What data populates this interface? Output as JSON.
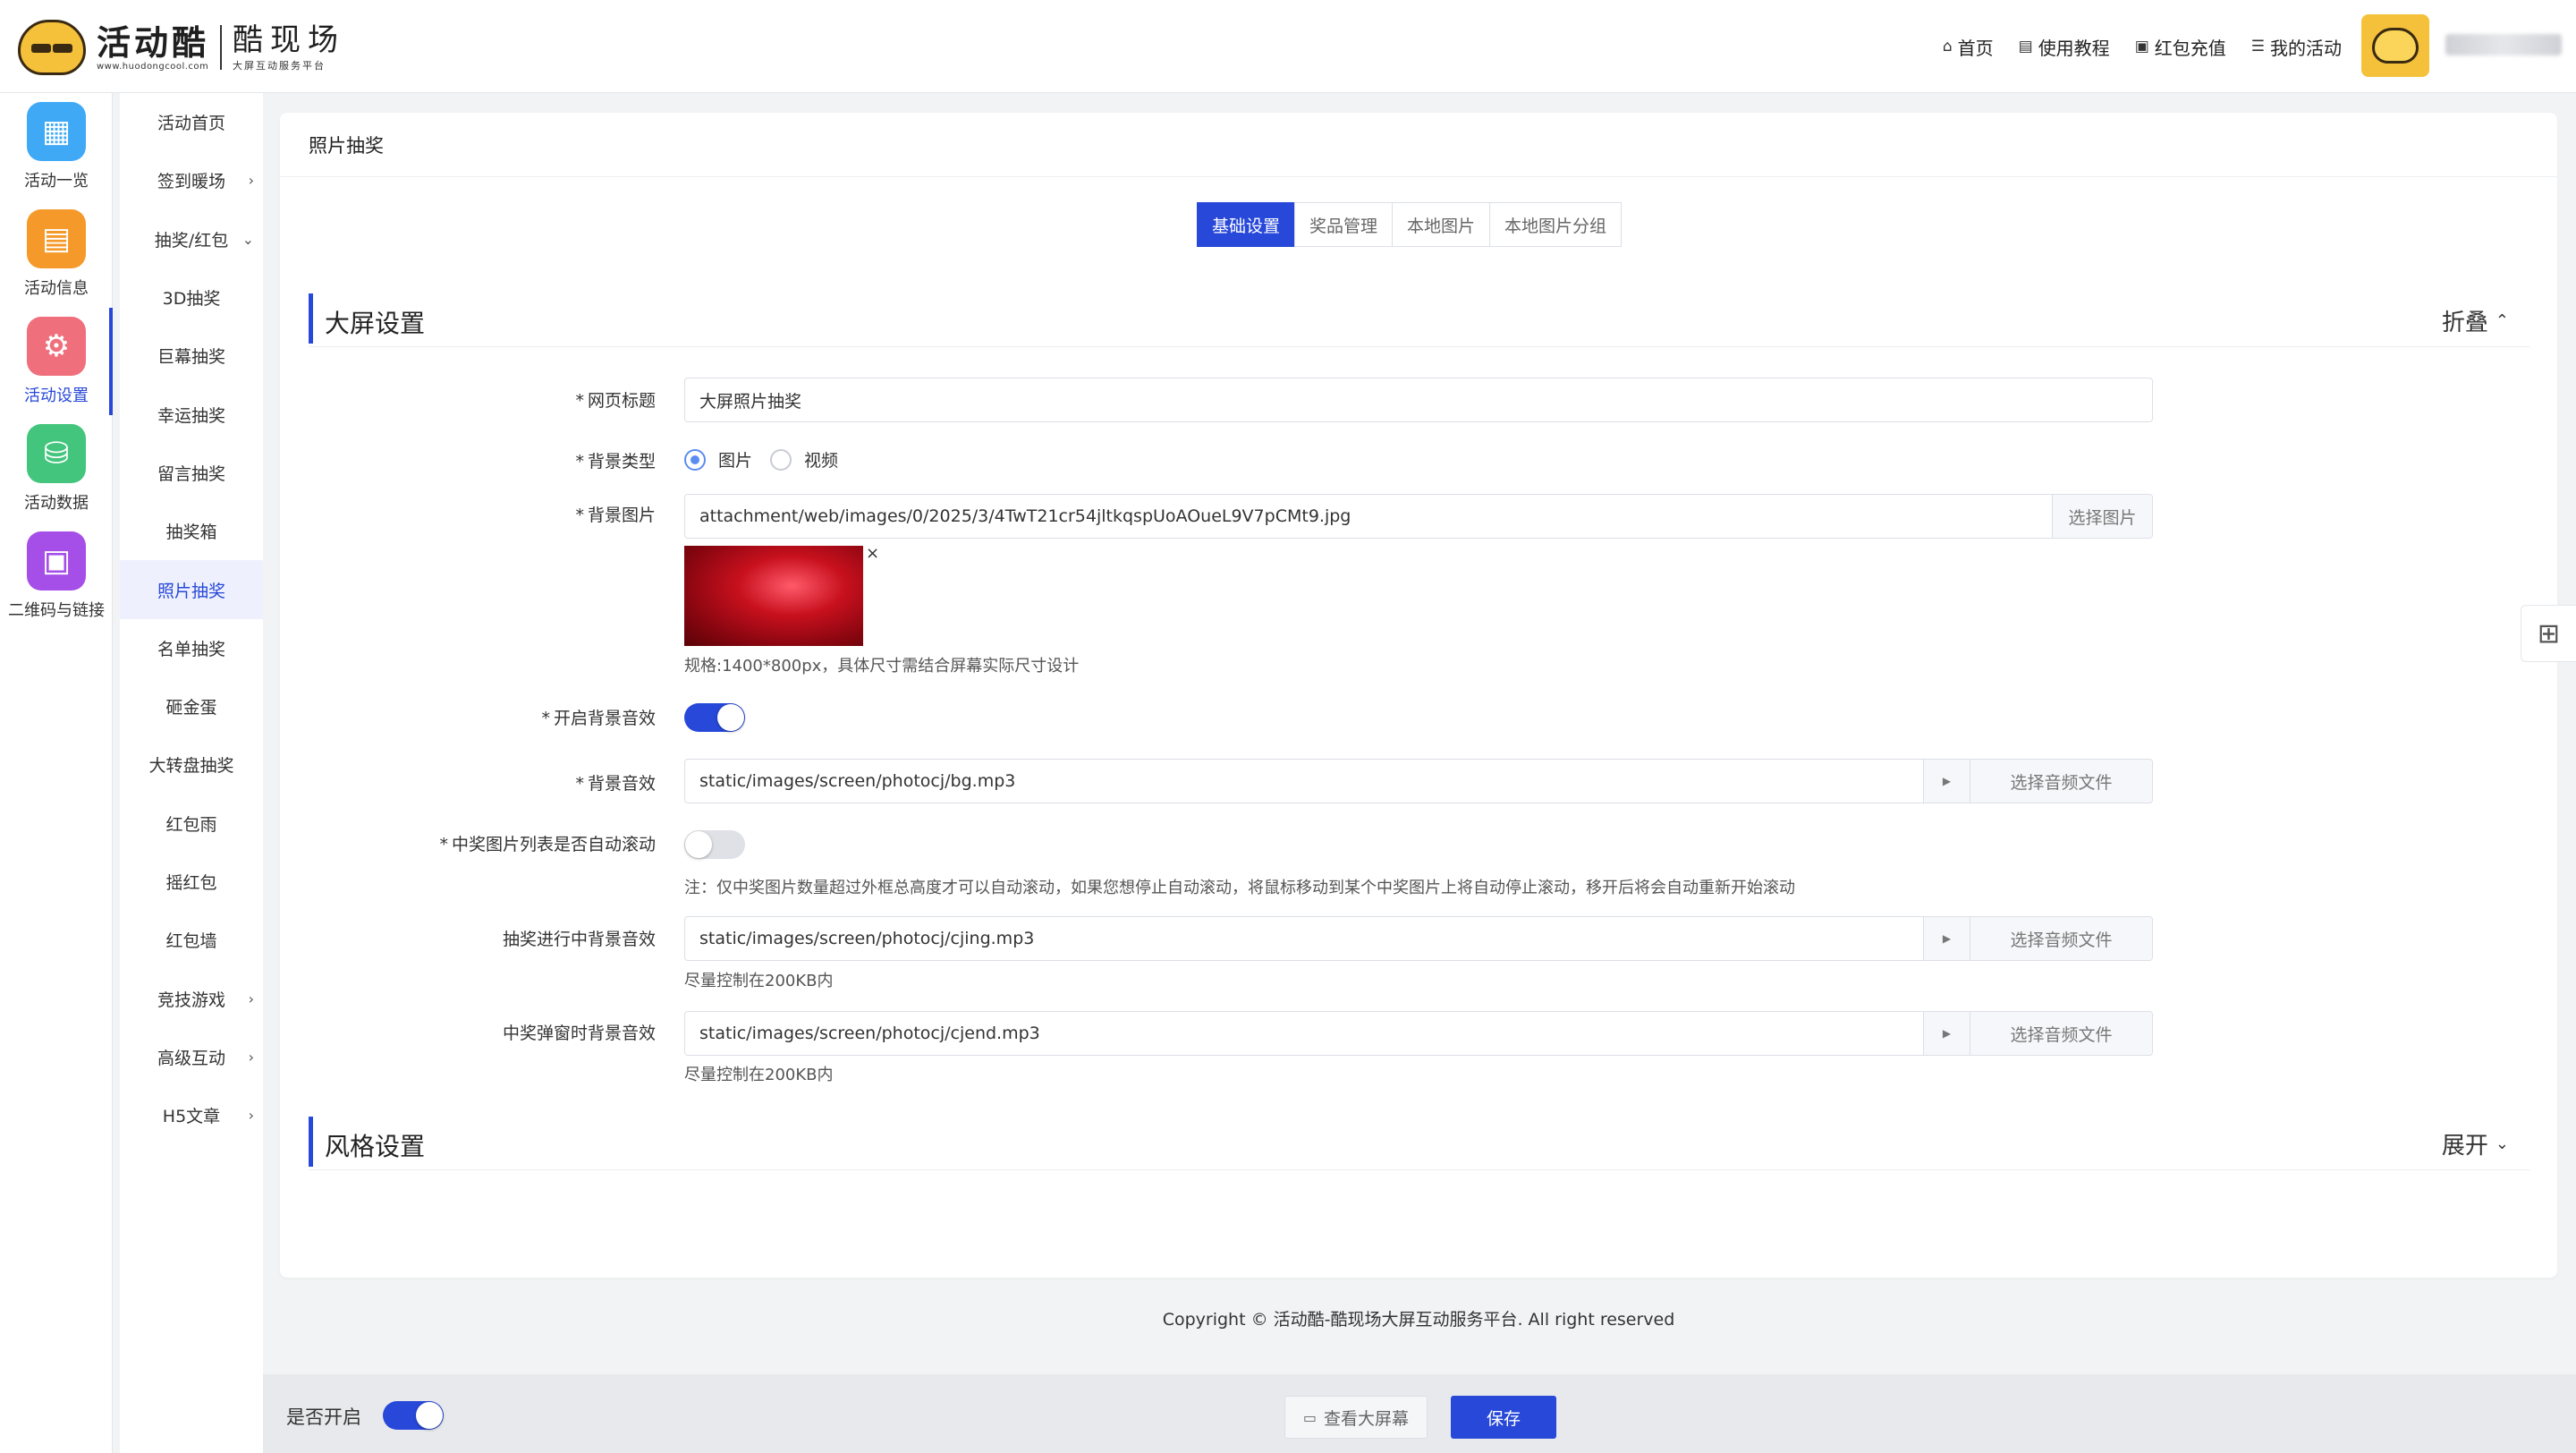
{
  "header": {
    "logo_cn": "活动酷",
    "logo_url": "www.huodongcool.com",
    "logo_cn2": "酷现场",
    "logo_sub": "大屏互动服务平台",
    "nav": [
      {
        "icon": "home-icon",
        "glyph": "⌂",
        "label": "首页"
      },
      {
        "icon": "doc-icon",
        "glyph": "▤",
        "label": "使用教程"
      },
      {
        "icon": "wallet-icon",
        "glyph": "▣",
        "label": "红包充值"
      },
      {
        "icon": "list-icon",
        "glyph": "☰",
        "label": "我的活动"
      }
    ]
  },
  "rail": [
    {
      "label": "活动一览",
      "color": "#3fa9f5",
      "glyph": "▦",
      "icon": "grid-icon"
    },
    {
      "label": "活动信息",
      "color": "#f59a2a",
      "glyph": "▤",
      "icon": "document-icon"
    },
    {
      "label": "活动设置",
      "color": "#ef6f7d",
      "glyph": "⚙",
      "icon": "gear-icon",
      "active": true
    },
    {
      "label": "活动数据",
      "color": "#43c57d",
      "glyph": "⛁",
      "icon": "database-icon"
    },
    {
      "label": "二维码与链接",
      "color": "#a64ee8",
      "glyph": "▣",
      "icon": "qrcode-icon"
    }
  ],
  "submenu": [
    {
      "label": "活动首页"
    },
    {
      "label": "签到暖场",
      "arrow": "›"
    },
    {
      "label": "抽奖/红包",
      "arrow": "⌄"
    },
    {
      "label": "3D抽奖"
    },
    {
      "label": "巨幕抽奖"
    },
    {
      "label": "幸运抽奖"
    },
    {
      "label": "留言抽奖"
    },
    {
      "label": "抽奖箱"
    },
    {
      "label": "照片抽奖",
      "active": true
    },
    {
      "label": "名单抽奖"
    },
    {
      "label": "砸金蛋"
    },
    {
      "label": "大转盘抽奖"
    },
    {
      "label": "红包雨"
    },
    {
      "label": "摇红包"
    },
    {
      "label": "红包墙"
    },
    {
      "label": "竞技游戏",
      "arrow": "›"
    },
    {
      "label": "高级互动",
      "arrow": "›"
    },
    {
      "label": "H5文章",
      "arrow": "›"
    }
  ],
  "card": {
    "title": "照片抽奖",
    "tabs": [
      "基础设置",
      "奖品管理",
      "本地图片",
      "本地图片分组"
    ],
    "section1": {
      "title": "大屏设置",
      "toggle": "折叠",
      "toggle_icon": "⌃"
    },
    "section2": {
      "title": "风格设置",
      "toggle": "展开",
      "toggle_icon": "⌄"
    },
    "form": {
      "page_title_label": "网页标题",
      "page_title_value": "大屏照片抽奖",
      "bg_type_label": "背景类型",
      "bg_type_options": [
        "图片",
        "视频"
      ],
      "bg_image_label": "背景图片",
      "bg_image_value": "attachment/web/images/0/2025/3/4TwT21cr54jltkqspUoAOueL9V7pCMt9.jpg",
      "bg_image_button": "选择图片",
      "bg_image_close": "×",
      "bg_image_hint": "规格:1400*800px，具体尺寸需结合屏幕实际尺寸设计",
      "bg_music_switch_label": "开启背景音效",
      "bg_music_label": "背景音效",
      "bg_music_value": "static/images/screen/photocj/bg.mp3",
      "audio_button": "选择音频文件",
      "play_glyph": "▶",
      "autoscroll_label": "中奖图片列表是否自动滚动",
      "autoscroll_note": "注：仅中奖图片数量超过外框总高度才可以自动滚动，如果您想停止自动滚动，将鼠标移动到某个中奖图片上将自动停止滚动，移开后将会自动重新开始滚动",
      "drawing_music_label": "抽奖进行中背景音效",
      "drawing_music_value": "static/images/screen/photocj/cjing.mp3",
      "size_hint": "尽量控制在200KB内",
      "popup_music_label": "中奖弹窗时背景音效",
      "popup_music_value": "static/images/screen/photocj/cjend.mp3"
    },
    "required_mark": "*"
  },
  "copyright": "Copyright © 活动酷-酷现场大屏互动服务平台. All right reserved",
  "footer": {
    "enable_label": "是否开启",
    "view_button": "查看大屏幕",
    "view_glyph": "▭",
    "save_button": "保存"
  },
  "float_glyph": "⊞",
  "switch_states": {
    "footer_enable": true,
    "bg_music": true,
    "autoscroll": false
  }
}
